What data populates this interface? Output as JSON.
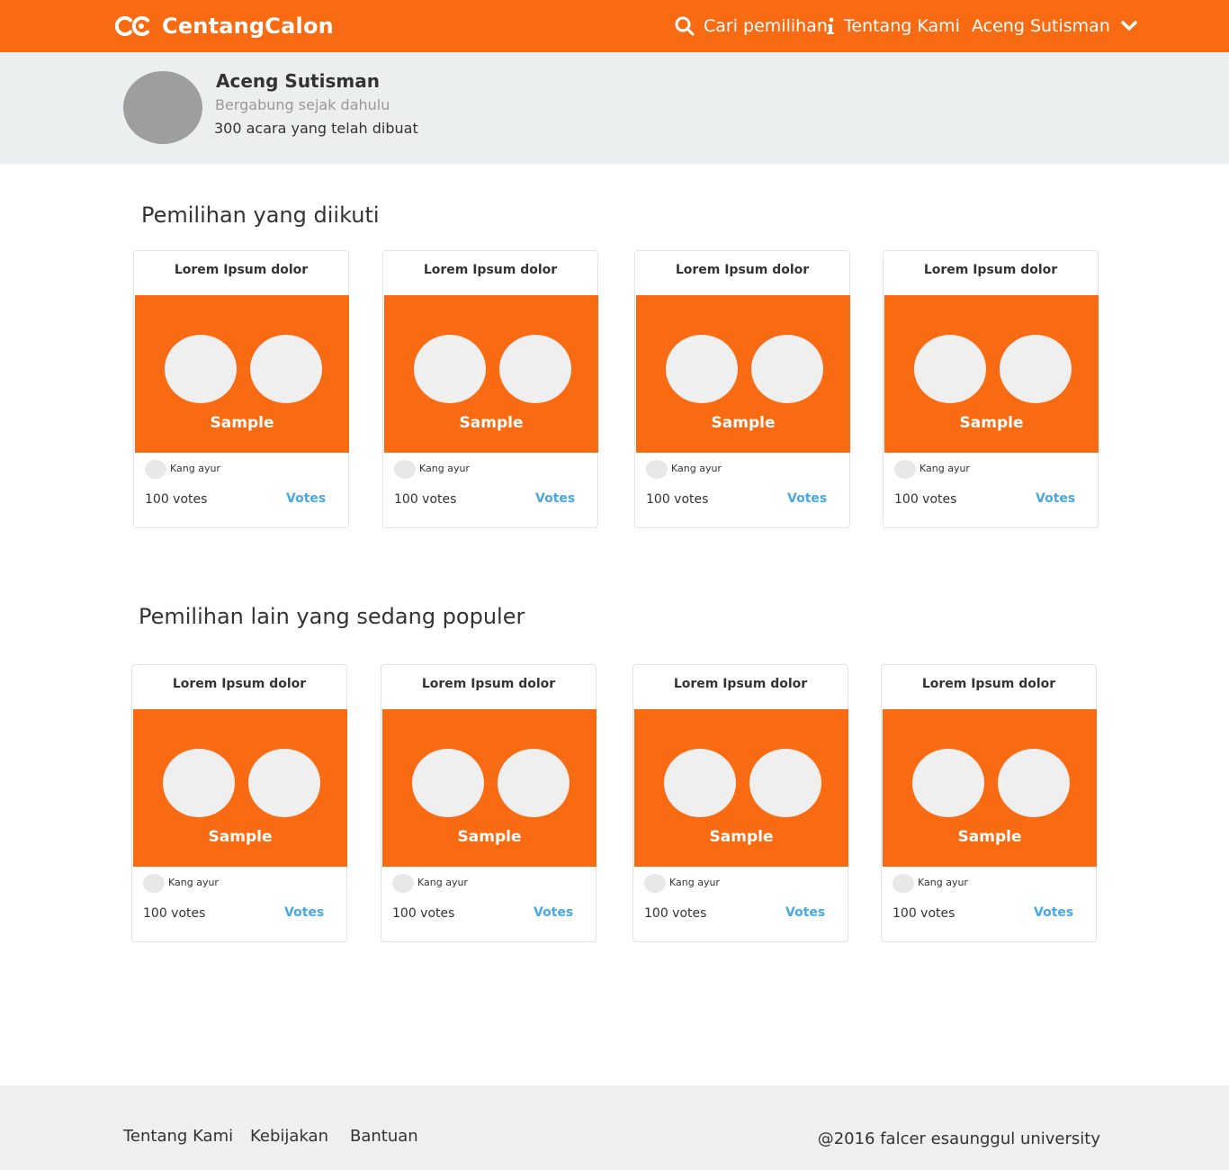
{
  "navbar": {
    "brand_name": "CentangCalon",
    "search_label": "Cari pemilihan",
    "about_label": "Tentang Kami",
    "user_label": "Aceng Sutisman"
  },
  "colors": {
    "brand": "#f96b12",
    "link": "#4aa8e0",
    "profile_bg": "#ecefef",
    "footer_bg": "#efefef"
  },
  "profile": {
    "name": "Aceng Sutisman",
    "since": "Bergabung sejak dahulu",
    "events_count": "300 acara yang telah dibuat"
  },
  "sections": [
    {
      "title": "Pemilihan yang diikuti",
      "cards": [
        {
          "title": "Lorem Ipsum dolor",
          "image_label": "Sample",
          "author": "Kang ayur",
          "votes": "100 votes",
          "vote_link": "Votes"
        },
        {
          "title": "Lorem Ipsum dolor",
          "image_label": "Sample",
          "author": "Kang ayur",
          "votes": "100 votes",
          "vote_link": "Votes"
        },
        {
          "title": "Lorem Ipsum dolor",
          "image_label": "Sample",
          "author": "Kang ayur",
          "votes": "100 votes",
          "vote_link": "Votes"
        },
        {
          "title": "Lorem Ipsum dolor",
          "image_label": "Sample",
          "author": "Kang ayur",
          "votes": "100 votes",
          "vote_link": "Votes"
        }
      ]
    },
    {
      "title": "Pemilihan lain yang sedang populer",
      "cards": [
        {
          "title": "Lorem Ipsum dolor",
          "image_label": "Sample",
          "author": "Kang ayur",
          "votes": "100 votes",
          "vote_link": "Votes"
        },
        {
          "title": "Lorem Ipsum dolor",
          "image_label": "Sample",
          "author": "Kang ayur",
          "votes": "100 votes",
          "vote_link": "Votes"
        },
        {
          "title": "Lorem Ipsum dolor",
          "image_label": "Sample",
          "author": "Kang ayur",
          "votes": "100 votes",
          "vote_link": "Votes"
        },
        {
          "title": "Lorem Ipsum dolor",
          "image_label": "Sample",
          "author": "Kang ayur",
          "votes": "100 votes",
          "vote_link": "Votes"
        }
      ]
    }
  ],
  "footer": {
    "links": [
      "Tentang Kami",
      "Kebijakan",
      "Bantuan"
    ],
    "copyright": "@2016 falcer esaunggul university"
  },
  "icons": {
    "logo": "cc-logo-icon",
    "search": "search-icon",
    "about": "info-icon",
    "user_menu": "chevron-down-icon"
  }
}
